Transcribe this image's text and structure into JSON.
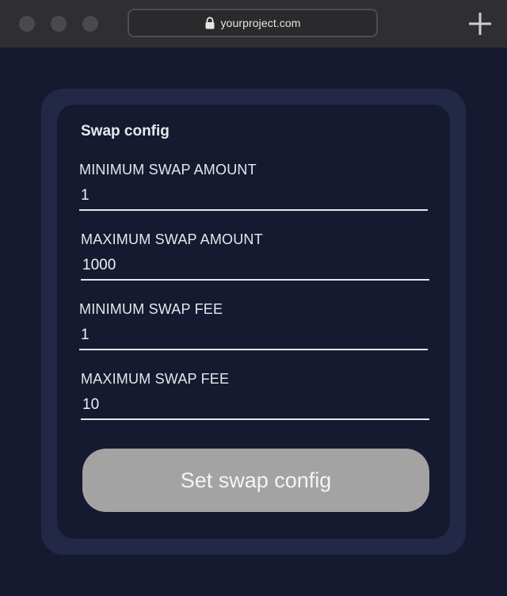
{
  "browser": {
    "url": "yourproject.com",
    "lock_icon": "lock-icon",
    "new_tab_icon": "plus-icon"
  },
  "form": {
    "title": "Swap config",
    "fields": [
      {
        "label": "MINIMUM SWAP AMOUNT",
        "value": "1"
      },
      {
        "label": "MAXIMUM SWAP AMOUNT",
        "value": "1000"
      },
      {
        "label": "MINIMUM SWAP FEE",
        "value": "1"
      },
      {
        "label": "MAXIMUM SWAP FEE",
        "value": "10"
      }
    ],
    "submit_label": "Set swap config"
  },
  "colors": {
    "background": "#151a30",
    "card_outer": "#222845",
    "button_disabled": "#a3a3a3",
    "browser_chrome": "#2f2f31"
  }
}
